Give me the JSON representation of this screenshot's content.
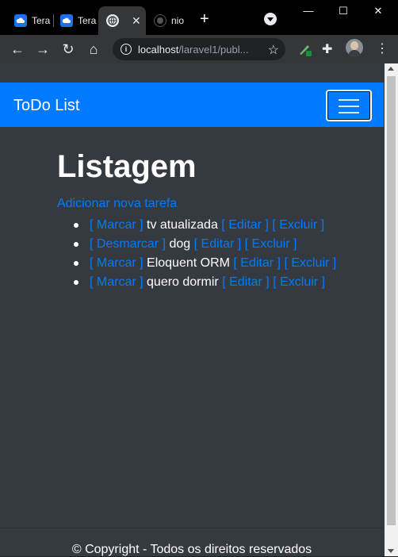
{
  "browser": {
    "tabs": [
      {
        "label": "Tera"
      },
      {
        "label": "Tera"
      },
      {
        "label": ""
      },
      {
        "label": "nio"
      }
    ],
    "new_tab_label": "+",
    "url_host": "localhost",
    "url_path": "/laravel1/publ...",
    "window_controls": {
      "minimize": "—",
      "maximize": "☐",
      "close": "✕"
    },
    "icons": [
      "back-arrow-icon",
      "forward-arrow-icon",
      "reload-icon",
      "home-icon",
      "info-icon",
      "star-icon",
      "extension-icon",
      "puzzle-icon",
      "profile-avatar",
      "more-menu-icon"
    ]
  },
  "navbar": {
    "brand": "ToDo List",
    "color": "#007bff"
  },
  "main": {
    "heading": "Listagem",
    "add_link": "Adicionar nova tarefa",
    "tasks": [
      {
        "toggle": "[ Marcar ]",
        "name": "tv atualizada",
        "edit": "[ Editar ]",
        "delete": "[ Excluir ]"
      },
      {
        "toggle": "[ Desmarcar ]",
        "name": "dog",
        "edit": "[ Editar ]",
        "delete": "[ Excluir ]"
      },
      {
        "toggle": "[ Marcar ]",
        "name": "Eloquent ORM",
        "edit": "[ Editar ]",
        "delete": "[ Excluir ]"
      },
      {
        "toggle": "[ Marcar ]",
        "name": "quero dormir",
        "edit": "[ Editar ]",
        "delete": "[ Excluir ]"
      }
    ]
  },
  "footer": {
    "text": "© Copyright - Todos os direitos reservados"
  },
  "colors": {
    "page_bg": "#343a40",
    "link": "#007bff",
    "text": "#ffffff"
  }
}
